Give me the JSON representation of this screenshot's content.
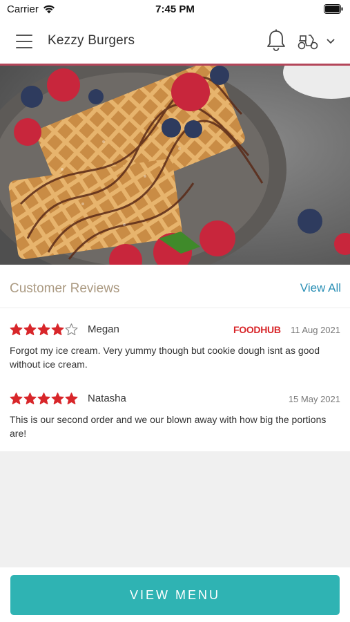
{
  "status_bar": {
    "carrier": "Carrier",
    "time": "7:45 PM"
  },
  "header": {
    "title": "Kezzy Burgers"
  },
  "hero": {
    "image": "waffles-with-berries-and-chocolate"
  },
  "reviews": {
    "title": "Customer Reviews",
    "view_all": "View All",
    "items": [
      {
        "rating": 4,
        "max_rating": 5,
        "name": "Megan",
        "source": "FOODHUB",
        "date": "11 Aug 2021",
        "text": "Forgot my ice cream. Very yummy though but cookie dough isnt as good without ice cream."
      },
      {
        "rating": 5,
        "max_rating": 5,
        "name": "Natasha",
        "date": "15 May 2021",
        "text": "This is our second order and we our blown away with how big the portions are!"
      }
    ]
  },
  "footer": {
    "button_label": "VIEW MENU"
  },
  "colors": {
    "accent": "#2fb3b3",
    "header_divider": "#b4465a",
    "star": "#d8262a",
    "link": "#2a8fb5",
    "reviews_title": "#ab9a82"
  }
}
